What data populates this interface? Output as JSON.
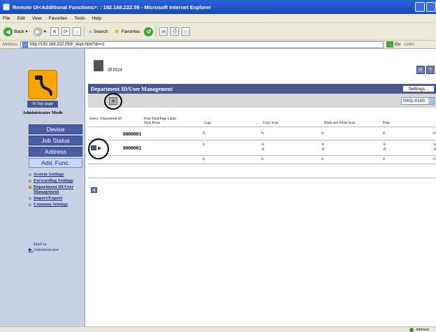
{
  "window": {
    "title": "Remote UI<Additional Functions>: : 192.168.222.59 - Microsoft Internet Explorer"
  },
  "menu": [
    "File",
    "Edit",
    "View",
    "Favorites",
    "Tools",
    "Help"
  ],
  "toolbar": {
    "back": "Back",
    "search": "Search",
    "favorites": "Favorites"
  },
  "address": {
    "label": "Address",
    "url": "http://192.168.222.059/_dept.html?dn=1",
    "go": "Go",
    "links": "Links"
  },
  "sidebar": {
    "top_page": "To Top page",
    "mode": "Administrator Mode",
    "nav": [
      {
        "label": "Device",
        "active": false
      },
      {
        "label": "Job Status",
        "active": false
      },
      {
        "label": "Address",
        "active": false
      },
      {
        "label": "Add. Func.",
        "active": true
      }
    ],
    "sub_links": [
      {
        "label": "System Settings",
        "active": false
      },
      {
        "label": "Forwarding Settings",
        "active": false
      },
      {
        "label": "Department ID/User Management",
        "active": true
      },
      {
        "label": "Import/Export",
        "active": false
      },
      {
        "label": "Common Settings",
        "active": false
      }
    ],
    "mail": "Mail to Administrator"
  },
  "main": {
    "device_name": "iR1024",
    "section_title": "Department ID/User Management",
    "settings_button": "Settings...",
    "range_select": "0001-0100",
    "table": {
      "header_top": {
        "select": "Select",
        "dept_id": "Department ID",
        "print_total": "Print Total/Page Limits"
      },
      "header_bottom": [
        "Total Prints",
        "Copy",
        "Color Scan",
        "Black and White Scan",
        "Print"
      ],
      "rows": [
        {
          "id": "0000001",
          "values": [
            "0",
            "0",
            "0",
            "0",
            "0"
          ],
          "limits": [
            "",
            "",
            "",
            "",
            ""
          ]
        },
        {
          "id": "0000002",
          "values": [
            "0",
            "0",
            "0",
            "0",
            "0"
          ],
          "limits": [
            "",
            "/0",
            "/0",
            "/0",
            "/0"
          ]
        },
        {
          "id": "",
          "values": [
            "0",
            "0",
            "0",
            "0",
            "0"
          ],
          "limits": [
            "",
            "",
            "",
            "",
            ""
          ]
        }
      ]
    }
  },
  "status": {
    "zone": "Internet"
  },
  "colors": {
    "titlebar": "#1a48b8",
    "sidebar": "#c8d0e4",
    "nav_button": "#4a5ea8",
    "section_bar": "#4a5890",
    "logo": "#f7a600"
  }
}
